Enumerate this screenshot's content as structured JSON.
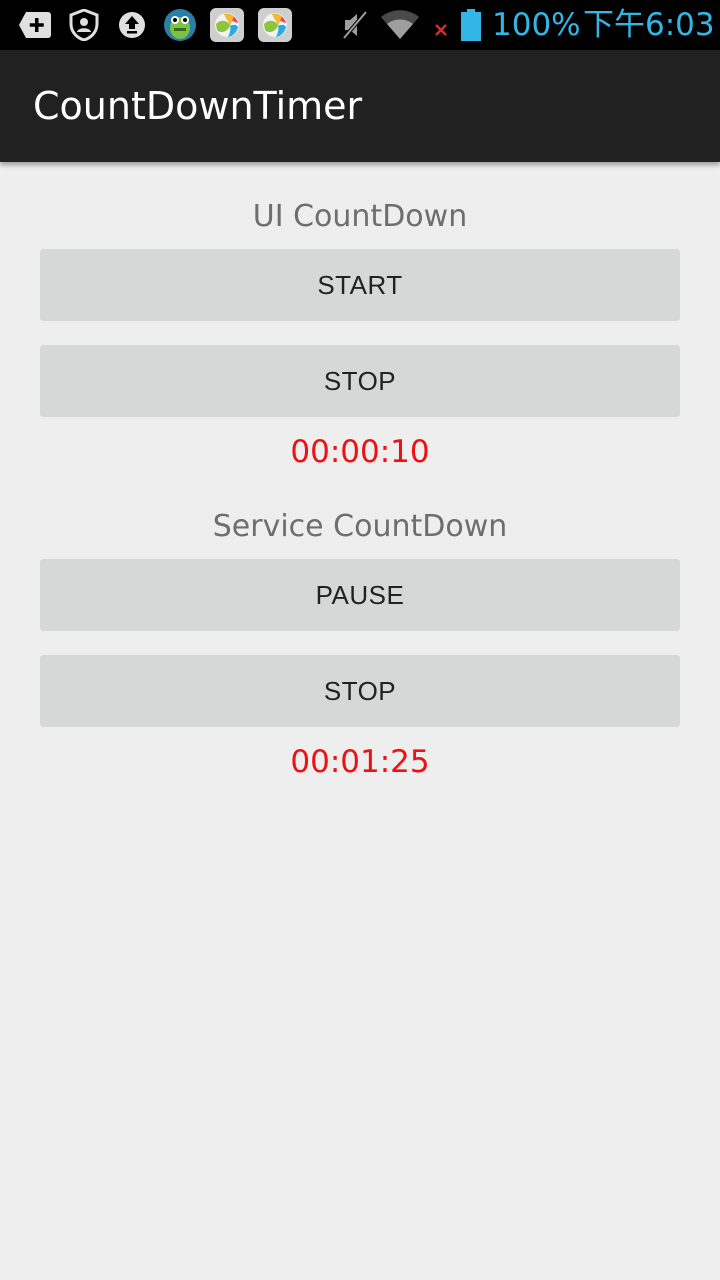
{
  "status_bar": {
    "battery": "100%",
    "time": "下午6:03",
    "icons": [
      "add-icon",
      "shield-user-icon",
      "upload-icon",
      "frog-app-icon",
      "ball-app-icon",
      "ball-app-icon-2",
      "mute-icon",
      "wifi-icon",
      "no-signal-x-icon",
      "battery-icon"
    ],
    "accent_color": "#33b5e5"
  },
  "action_bar": {
    "title": "CountDownTimer"
  },
  "ui_section": {
    "title": "UI CountDown",
    "start_label": "START",
    "stop_label": "STOP",
    "timer": "00:00:10"
  },
  "service_section": {
    "title": "Service CountDown",
    "pause_label": "PAUSE",
    "stop_label": "STOP",
    "timer": "00:01:25"
  },
  "colors": {
    "timer": "#ee1111",
    "button_bg": "#d6d7d7",
    "action_bar_bg": "#212121",
    "page_bg": "#eeeeee"
  }
}
